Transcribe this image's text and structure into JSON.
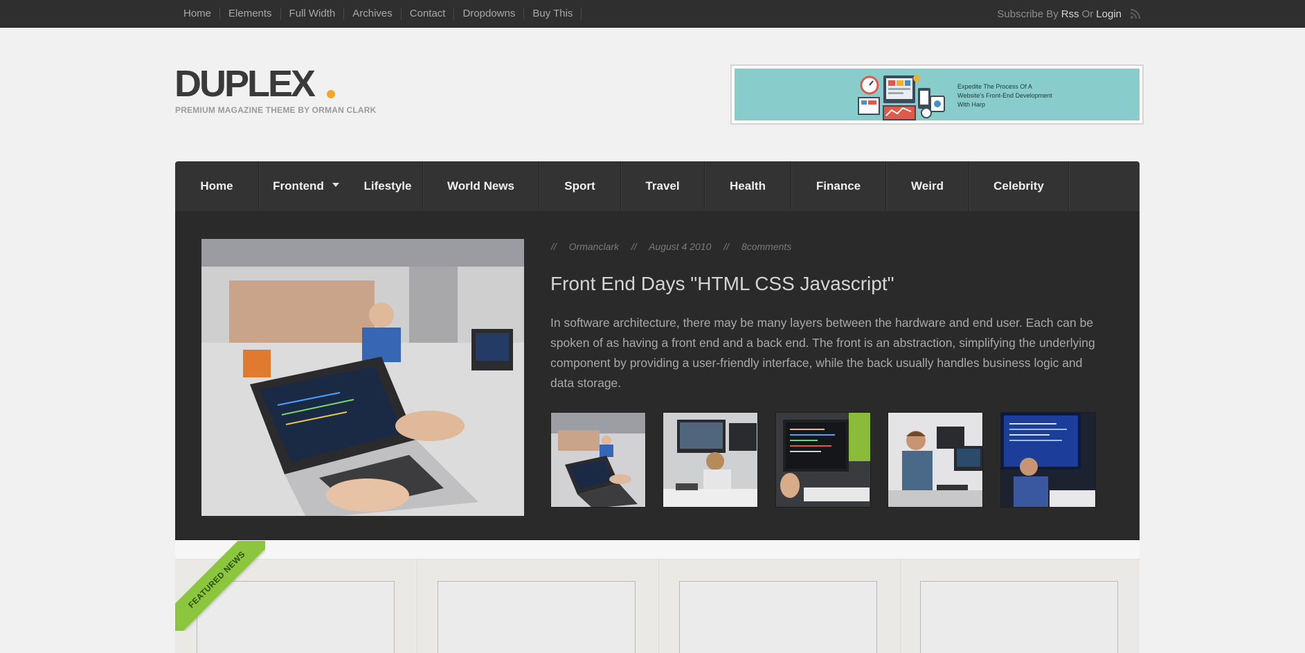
{
  "topbar": {
    "nav": [
      "Home",
      "Elements",
      "Full Width",
      "Archives",
      "Contact",
      "Dropdowns",
      "Buy This"
    ],
    "subscribe_prefix": "Subscribe By",
    "rss_label": "Rss",
    "or_label": "Or",
    "login_label": "Login"
  },
  "header": {
    "logo": "DUPLEX",
    "tagline": "PREMIUM MAGAZINE THEME BY ORMAN CLARK",
    "ad_text": "Expedite The Process Of A Website's Front-End Development With Harp"
  },
  "mainnav": {
    "items": [
      "Home",
      "Frontend",
      "Lifestyle",
      "World News",
      "Sport",
      "Travel",
      "Health",
      "Finance",
      "Weird",
      "Celebrity"
    ]
  },
  "feature": {
    "meta": [
      "//",
      "Ormanclark",
      "//",
      "August 4 2010",
      "//",
      "8comments"
    ],
    "title": "Front End Days \"HTML CSS Javascript\"",
    "excerpt": "In software architecture, there may be many layers between the hardware and end user. Each can be spoken of as having a front end and a back end. The front is an abstraction, simplifying the underlying component by providing a user-friendly interface, while the back usually handles business logic and data storage."
  },
  "news": {
    "ribbon": "FEATURED NEWS"
  },
  "colors": {
    "accent_orange": "#f5a623",
    "ribbon_green": "#8cc63f",
    "ad_teal": "#88cccc"
  }
}
